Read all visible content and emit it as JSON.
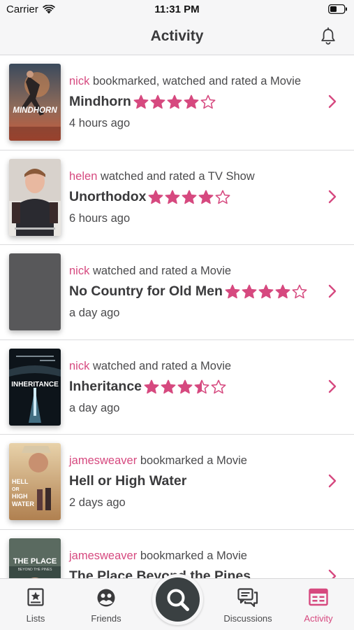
{
  "status_bar": {
    "carrier": "Carrier",
    "time": "11:31 PM"
  },
  "nav": {
    "title": "Activity"
  },
  "colors": {
    "accent": "#d6497f",
    "text": "#3a3a3c",
    "fab": "#3a4042"
  },
  "feed": [
    {
      "user": "nick",
      "action": "bookmarked, watched and rated a Movie",
      "title": "Mindhorn",
      "rating": 4,
      "time": "4 hours ago"
    },
    {
      "user": "helen",
      "action": "watched and rated a TV Show",
      "title": "Unorthodox",
      "rating": 4,
      "time": "6 hours ago"
    },
    {
      "user": "nick",
      "action": "watched and rated a Movie",
      "title": "No Country for Old Men",
      "rating": 4,
      "time": "a day ago"
    },
    {
      "user": "nick",
      "action": "watched and rated a Movie",
      "title": "Inheritance",
      "rating": 3.5,
      "time": "a day ago"
    },
    {
      "user": "jamesweaver",
      "action": "bookmarked a Movie",
      "title": "Hell or High Water",
      "rating": null,
      "time": "2 days ago"
    },
    {
      "user": "jamesweaver",
      "action": "bookmarked a Movie",
      "title": "The Place Beyond the Pines",
      "rating": null,
      "time": ""
    }
  ],
  "posters": {
    "mindhorn": "MINDHORN",
    "inheritance": "INHERITANCE",
    "hell_or_high_water": [
      "HELL",
      "OR",
      "HIGH",
      "WATER"
    ],
    "the_place": "THE PLACE",
    "the_place_sub": "BEYOND THE PINES"
  },
  "tabs": [
    {
      "label": "Lists",
      "icon": "list-star-icon"
    },
    {
      "label": "Friends",
      "icon": "friends-icon"
    },
    {
      "label": "Discussions",
      "icon": "discussions-icon"
    },
    {
      "label": "Activity",
      "icon": "calendar-activity-icon",
      "active": true
    }
  ],
  "search_button": {
    "icon": "search-icon"
  }
}
